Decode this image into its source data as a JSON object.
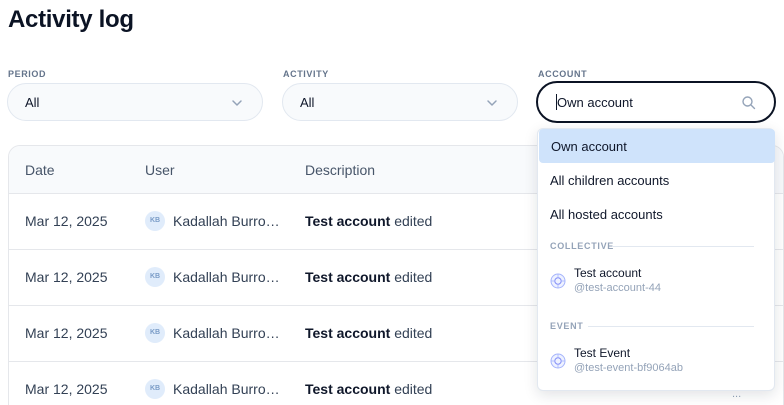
{
  "page": {
    "title": "Activity log"
  },
  "filters": {
    "period": {
      "label": "PERIOD",
      "value": "All"
    },
    "activity": {
      "label": "ACTIVITY",
      "value": "All"
    },
    "account": {
      "label": "ACCOUNT",
      "value": "Own account"
    }
  },
  "table": {
    "columns": [
      "Date",
      "User",
      "Description"
    ],
    "rows": [
      {
        "date": "Mar 12, 2025",
        "avatar": "KB",
        "user": "Kadallah Burrowes",
        "desc_strong": "Test account",
        "desc_rest": " edited"
      },
      {
        "date": "Mar 12, 2025",
        "avatar": "KB",
        "user": "Kadallah Burrowes",
        "desc_strong": "Test account",
        "desc_rest": " edited"
      },
      {
        "date": "Mar 12, 2025",
        "avatar": "KB",
        "user": "Kadallah Burrowes",
        "desc_strong": "Test account",
        "desc_rest": " edited"
      },
      {
        "date": "Mar 12, 2025",
        "avatar": "KB",
        "user": "Kadallah Burrowes",
        "desc_strong": "Test account",
        "desc_rest": " edited"
      }
    ]
  },
  "dropdown": {
    "options": [
      "Own account",
      "All children accounts",
      "All hosted accounts"
    ],
    "selected_index": 0,
    "groups": [
      {
        "label": "COLLECTIVE",
        "items": [
          {
            "name": "Test account",
            "slug": "@test-account-44",
            "icon": "collective-icon"
          }
        ]
      },
      {
        "label": "EVENT",
        "items": [
          {
            "name": "Test Event",
            "slug": "@test-event-bf9064ab",
            "icon": "event-icon"
          }
        ]
      }
    ]
  },
  "icons": {
    "chevron": "chevron-down-icon",
    "search": "search-icon",
    "avatar_fallback": "avatar"
  },
  "colors": {
    "selected_bg": "#cfe3fb",
    "focus_border": "#0b1324",
    "muted": "#94a3b8"
  },
  "more_indicator": "..."
}
